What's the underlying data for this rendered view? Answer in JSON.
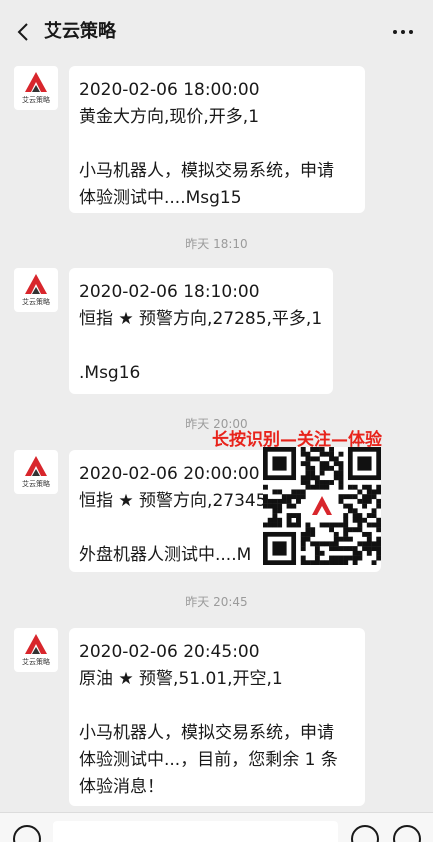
{
  "header": {
    "title": "艾云策略"
  },
  "avatar_label": "艾云策略",
  "messages": [
    {
      "lines": [
        "2020-02-06 18:00:00",
        "黄金大方向,现价,开多,1",
        "",
        "小马机器人，模拟交易系统，申请",
        "体验测试中....Msg15"
      ]
    },
    {
      "lines": [
        "2020-02-06 18:10:00",
        "恒指 ★ 预警方向,27285,平多,1",
        "",
        ".Msg16"
      ]
    },
    {
      "lines": [
        "2020-02-06 20:00:00",
        "恒指 ★ 预警方向,27345",
        "",
        "外盘机器人测试中....M"
      ]
    },
    {
      "lines": [
        "2020-02-06 20:45:00",
        "原油 ★ 预警,51.01,开空,1",
        "",
        "小马机器人，模拟交易系统，申请",
        "体验测试中...，目前，您剩余 1 条",
        "体验消息！"
      ]
    }
  ],
  "timestamps": [
    "昨天 18:10",
    "昨天 20:00",
    "昨天 20:45"
  ],
  "overlay": {
    "text": "长按识别—关注—体验",
    "color": "#e8231b"
  },
  "icons": {
    "back": "back-chevron-icon",
    "more": "more-dots-icon",
    "voice": "voice-icon",
    "emoji": "emoji-icon",
    "plus": "plus-icon"
  }
}
